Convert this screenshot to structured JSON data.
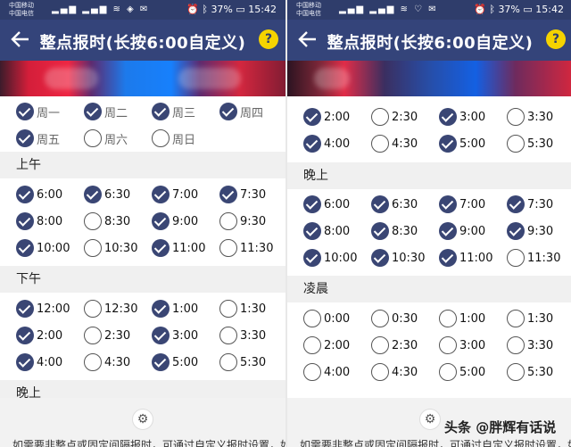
{
  "status": {
    "carrier1": "中国移动",
    "carrier2": "中国电信",
    "network_tags": "2G 4G",
    "battery": "37%",
    "time": "15:42"
  },
  "header": {
    "title": "整点报时(长按6:00自定义)",
    "help": "?"
  },
  "left": {
    "days": [
      {
        "label": "周一",
        "checked": true
      },
      {
        "label": "周二",
        "checked": true
      },
      {
        "label": "周三",
        "checked": true
      },
      {
        "label": "周四",
        "checked": true
      },
      {
        "label": "周五",
        "checked": true
      },
      {
        "label": "周六",
        "checked": false
      },
      {
        "label": "周日",
        "checked": false
      }
    ],
    "morning_title": "上午",
    "morning": [
      {
        "label": "6:00",
        "checked": true
      },
      {
        "label": "6:30",
        "checked": true
      },
      {
        "label": "7:00",
        "checked": true
      },
      {
        "label": "7:30",
        "checked": true
      },
      {
        "label": "8:00",
        "checked": true
      },
      {
        "label": "8:30",
        "checked": false
      },
      {
        "label": "9:00",
        "checked": true
      },
      {
        "label": "9:30",
        "checked": false
      },
      {
        "label": "10:00",
        "checked": true
      },
      {
        "label": "10:30",
        "checked": false
      },
      {
        "label": "11:00",
        "checked": true
      },
      {
        "label": "11:30",
        "checked": false
      }
    ],
    "afternoon_title": "下午",
    "afternoon": [
      {
        "label": "12:00",
        "checked": true
      },
      {
        "label": "12:30",
        "checked": false
      },
      {
        "label": "1:00",
        "checked": true
      },
      {
        "label": "1:30",
        "checked": false
      },
      {
        "label": "2:00",
        "checked": true
      },
      {
        "label": "2:30",
        "checked": false
      },
      {
        "label": "3:00",
        "checked": true
      },
      {
        "label": "3:30",
        "checked": false
      },
      {
        "label": "4:00",
        "checked": true
      },
      {
        "label": "4:30",
        "checked": false
      },
      {
        "label": "5:00",
        "checked": true
      },
      {
        "label": "5:30",
        "checked": false
      }
    ],
    "evening_title": "晚上"
  },
  "right": {
    "afternoon_tail": [
      {
        "label": "2:00",
        "checked": true
      },
      {
        "label": "2:30",
        "checked": false
      },
      {
        "label": "3:00",
        "checked": true
      },
      {
        "label": "3:30",
        "checked": false
      },
      {
        "label": "4:00",
        "checked": true
      },
      {
        "label": "4:30",
        "checked": false
      },
      {
        "label": "5:00",
        "checked": true
      },
      {
        "label": "5:30",
        "checked": false
      }
    ],
    "evening_title": "晚上",
    "evening": [
      {
        "label": "6:00",
        "checked": true
      },
      {
        "label": "6:30",
        "checked": true
      },
      {
        "label": "7:00",
        "checked": true
      },
      {
        "label": "7:30",
        "checked": true
      },
      {
        "label": "8:00",
        "checked": true
      },
      {
        "label": "8:30",
        "checked": true
      },
      {
        "label": "9:00",
        "checked": true
      },
      {
        "label": "9:30",
        "checked": true
      },
      {
        "label": "10:00",
        "checked": true
      },
      {
        "label": "10:30",
        "checked": true
      },
      {
        "label": "11:00",
        "checked": true
      },
      {
        "label": "11:30",
        "checked": false
      }
    ],
    "night_title": "凌晨",
    "night": [
      {
        "label": "0:00",
        "checked": false
      },
      {
        "label": "0:30",
        "checked": false
      },
      {
        "label": "1:00",
        "checked": false
      },
      {
        "label": "1:30",
        "checked": false
      },
      {
        "label": "2:00",
        "checked": false
      },
      {
        "label": "2:30",
        "checked": false
      },
      {
        "label": "3:00",
        "checked": false
      },
      {
        "label": "3:30",
        "checked": false
      },
      {
        "label": "4:00",
        "checked": false
      },
      {
        "label": "4:30",
        "checked": false
      },
      {
        "label": "5:00",
        "checked": false
      },
      {
        "label": "5:30",
        "checked": false
      }
    ]
  },
  "footer": {
    "hint_left": "如需要非整点或固定间隔报时，可通过自定义报时设置，如",
    "hint_right": "如需要非整点或固定间隔报时，可通过自定义报时设置，如",
    "watermark": "头条 @胖辉有话说"
  },
  "colors": {
    "primary": "#34447a",
    "check": "#3a4674",
    "help": "#f5d300"
  }
}
